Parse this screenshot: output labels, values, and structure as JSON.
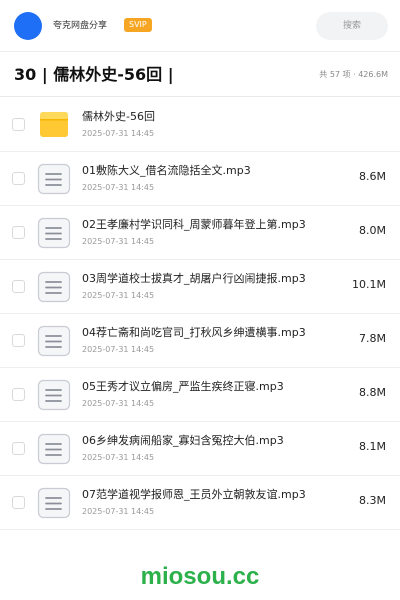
{
  "header": {
    "username": "夸克网盘分享",
    "badge": "SVIP",
    "search_placeholder": "搜索"
  },
  "folder": {
    "title": "30 | 儒林外史-56回 |",
    "meta": "共 57 项 · 426.6M"
  },
  "files": [
    {
      "name": "儒林外史-56回",
      "date": "2025-07-31 14:45",
      "size": "",
      "icon": "folder-icon"
    },
    {
      "name": "01敷陈大义_借名流隐括全文.mp3",
      "date": "2025-07-31 14:45",
      "size": "8.6M",
      "icon": "audio-file-icon"
    },
    {
      "name": "02王孝廉村学识同科_周蒙师暮年登上第.mp3",
      "date": "2025-07-31 14:45",
      "size": "8.0M",
      "icon": "audio-file-icon"
    },
    {
      "name": "03周学道校士拔真才_胡屠户行凶闹捷报.mp3",
      "date": "2025-07-31 14:45",
      "size": "10.1M",
      "icon": "audio-file-icon"
    },
    {
      "name": "04荐亡斋和尚吃官司_打秋风乡绅遭横事.mp3",
      "date": "2025-07-31 14:45",
      "size": "7.8M",
      "icon": "audio-file-icon"
    },
    {
      "name": "05王秀才议立偏房_严监生疾终正寝.mp3",
      "date": "2025-07-31 14:45",
      "size": "8.8M",
      "icon": "audio-file-icon"
    },
    {
      "name": "06乡绅发病闹船家_寡妇含冤控大伯.mp3",
      "date": "2025-07-31 14:45",
      "size": "8.1M",
      "icon": "audio-file-icon"
    },
    {
      "name": "07范学道视学报师恩_王员外立朝敦友谊.mp3",
      "date": "2025-07-31 14:45",
      "size": "8.3M",
      "icon": "audio-file-icon"
    }
  ],
  "watermark": "miosou.cc",
  "colors": {
    "accent": "#1e6ff5",
    "badge": "#f6a623",
    "folder": "#ffc933",
    "watermark": "#2bb04a"
  }
}
